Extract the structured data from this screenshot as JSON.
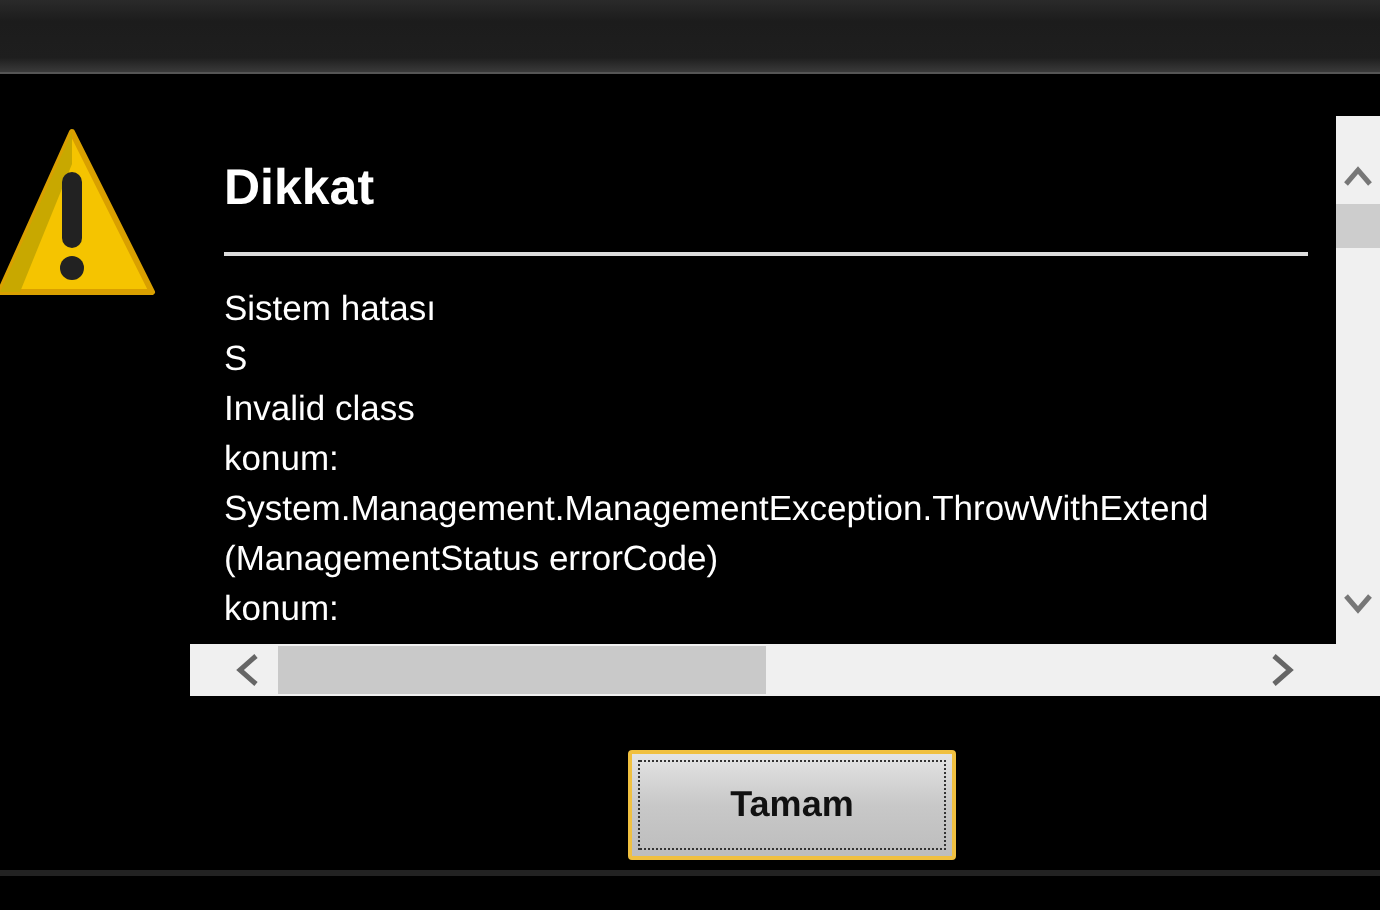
{
  "dialog": {
    "title": "Dikkat",
    "message_lines": [
      "Sistem hatası",
      "S",
      "Invalid class",
      "konum:",
      "System.Management.ManagementException.ThrowWithExtend",
      "(ManagementStatus errorCode)",
      "konum:"
    ],
    "buttons": [
      {
        "label": "Tamam",
        "selected": true
      }
    ]
  }
}
